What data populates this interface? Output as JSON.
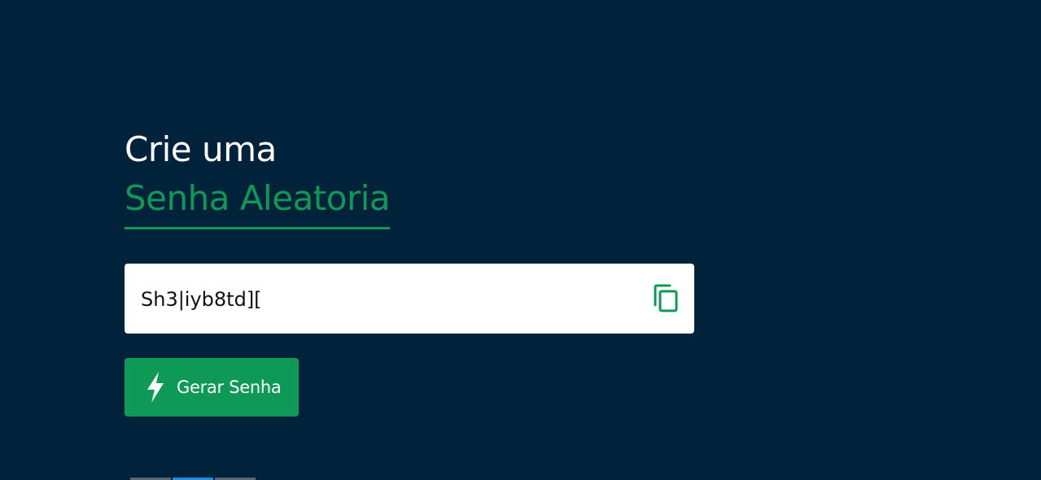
{
  "heading": {
    "line1": "Crie uma",
    "line2": "Senha Aleatoria"
  },
  "password": {
    "value": "Sh3|iyb8td]["
  },
  "copy_button": {
    "icon": "copy-icon"
  },
  "generate_button": {
    "icon": "lightning-bolt-icon",
    "label": "Gerar Senha"
  },
  "colors": {
    "background": "#00223a",
    "accent": "#0e9a56",
    "text_primary": "#ffffff",
    "strip": [
      "#5a6670",
      "#1e8fd8",
      "#5a6670"
    ]
  }
}
